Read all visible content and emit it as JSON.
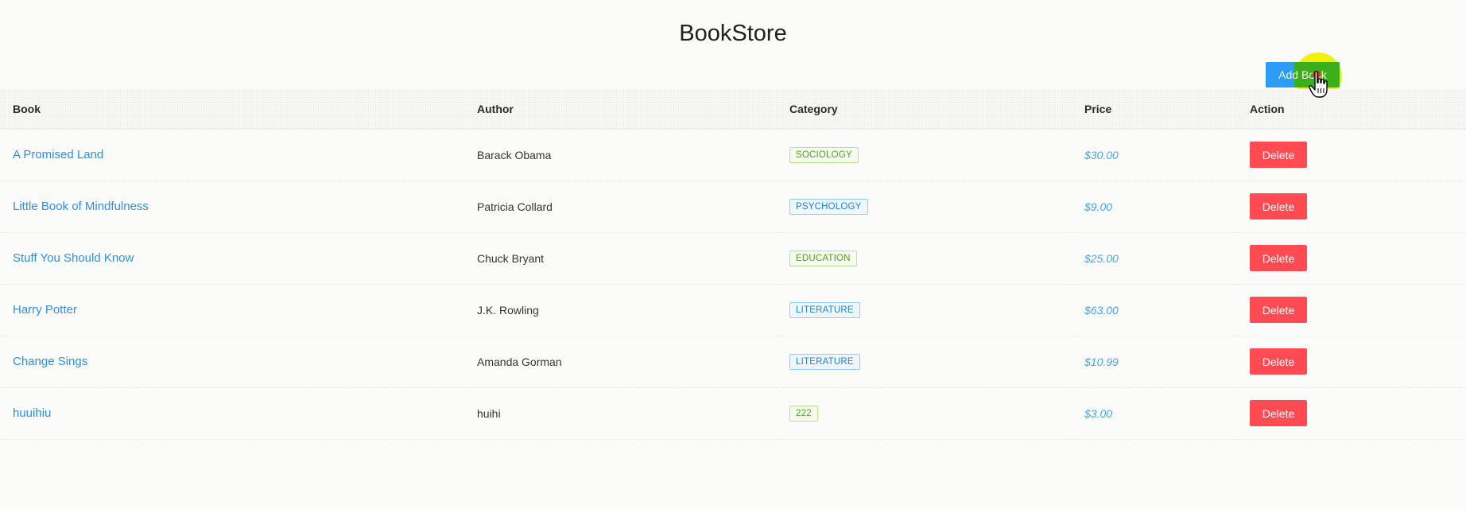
{
  "app": {
    "title": "BookStore"
  },
  "toolbar": {
    "add_label": "Add Book"
  },
  "table": {
    "headers": [
      "Book",
      "Author",
      "Category",
      "Price",
      "Action"
    ],
    "rows": [
      {
        "book": "A Promised Land",
        "author": "Barack Obama",
        "category": "SOCIOLOGY",
        "category_color": "green",
        "price": "$30.00",
        "action": "Delete"
      },
      {
        "book": "Little Book of Mindfulness",
        "author": "Patricia Collard",
        "category": "PSYCHOLOGY",
        "category_color": "blue",
        "price": "$9.00",
        "action": "Delete"
      },
      {
        "book": "Stuff You Should Know",
        "author": "Chuck Bryant",
        "category": "EDUCATION",
        "category_color": "green",
        "price": "$25.00",
        "action": "Delete"
      },
      {
        "book": "Harry Potter",
        "author": "J.K. Rowling",
        "category": "LITERATURE",
        "category_color": "blue",
        "price": "$63.00",
        "action": "Delete"
      },
      {
        "book": "Change Sings",
        "author": "Amanda Gorman",
        "category": "LITERATURE",
        "category_color": "blue",
        "price": "$10.99",
        "action": "Delete"
      },
      {
        "book": "huuihiu",
        "author": "huihi",
        "category": "222",
        "category_color": "green",
        "price": "$3.00",
        "action": "Delete"
      }
    ]
  },
  "colors": {
    "primary": "#2d9cf6",
    "danger": "#ff4b51",
    "link": "#2f8ee8",
    "tag_green": "#52a31f",
    "tag_blue": "#1d82d8",
    "cursor_highlight": "#f0f000"
  },
  "icons": {
    "cursor": "hand-pointer-icon"
  }
}
